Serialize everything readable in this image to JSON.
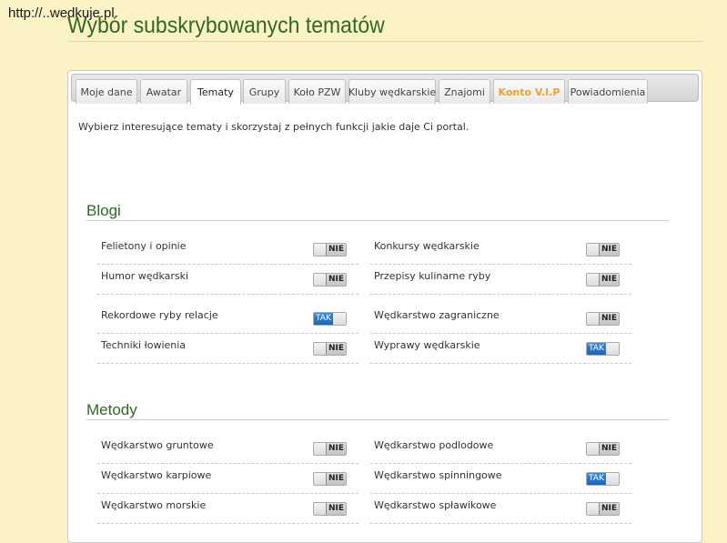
{
  "header": {
    "url": "http://..wedkuje.pl",
    "title": "Wybór subskrybowanych tematów"
  },
  "tabs": [
    {
      "label": "Moje dane",
      "active": false
    },
    {
      "label": "Awatar",
      "active": false
    },
    {
      "label": "Tematy",
      "active": true
    },
    {
      "label": "Grupy",
      "active": false
    },
    {
      "label": "Koło PZW",
      "active": false
    },
    {
      "label": "Kluby wędkarskie",
      "active": false
    },
    {
      "label": "Znajomi",
      "active": false
    },
    {
      "label": "Konto V.I.P",
      "active": false,
      "highlight": true
    },
    {
      "label": "Powiadomienia",
      "active": false
    }
  ],
  "intro": "Wybierz interesujące tematy i skorzystaj z pełnych funkcji jakie daje Ci portal.",
  "colors": {
    "accent_green": "#2f6a23",
    "vip_orange": "#f0a030",
    "toggle_on_blue": "#2a78c8",
    "background": "#fbf3c6"
  },
  "sections": [
    {
      "title": "Blogi",
      "topics": [
        {
          "label": "Felietony i opinie",
          "state": "NIE"
        },
        {
          "label": "Konkursy wędkarskie",
          "state": "NIE"
        },
        {
          "label": "Humor wędkarski",
          "state": "NIE"
        },
        {
          "label": "Przepisy kulinarne ryby",
          "state": "NIE"
        },
        {
          "label": "Rekordowe ryby relacje",
          "state": "TAK"
        },
        {
          "label": "Wędkarstwo zagraniczne",
          "state": "NIE"
        },
        {
          "label": "Techniki łowienia",
          "state": "NIE"
        },
        {
          "label": "Wyprawy wędkarskie",
          "state": "TAK"
        }
      ]
    },
    {
      "title": "Metody",
      "topics": [
        {
          "label": "Wędkarstwo gruntowe",
          "state": "NIE"
        },
        {
          "label": "Wędkarstwo podlodowe",
          "state": "NIE"
        },
        {
          "label": "Wędkarstwo karpiowe",
          "state": "NIE"
        },
        {
          "label": "Wędkarstwo spinningowe",
          "state": "TAK"
        },
        {
          "label": "Wędkarstwo morskie",
          "state": "NIE"
        },
        {
          "label": "Wędkarstwo spławikowe",
          "state": "NIE"
        }
      ]
    }
  ]
}
